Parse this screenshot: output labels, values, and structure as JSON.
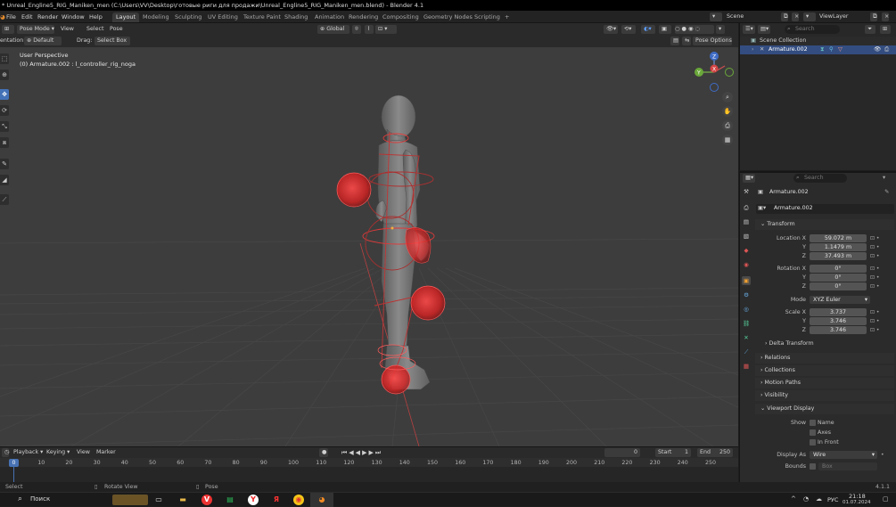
{
  "window_title": "* Unreal_Engline5_RIG_Maniken_men (C:\\Users\\VV\\Desktop\\готовые риги для продажи\\Unreal_Engline5_RIG_Maniken_men.blend) - Blender 4.1",
  "menu": [
    "File",
    "Edit",
    "Render",
    "Window",
    "Help"
  ],
  "workspaces": [
    "Layout",
    "Modeling",
    "Sculpting",
    "UV Editing",
    "Texture Paint",
    "Shading",
    "Animation",
    "Rendering",
    "Compositing",
    "Geometry Nodes",
    "Scripting"
  ],
  "workspace_add": "+",
  "scene": {
    "label": "Scene",
    "view_layer": "ViewLayer"
  },
  "viewport_header": {
    "orientation_label": "entation:",
    "orientation_value": "Default",
    "drag_label": "Drag:",
    "drag_value": "Select Box",
    "mode": "Pose Mode",
    "menus": [
      "View",
      "Select",
      "Pose"
    ],
    "transform": "Global",
    "pose_options": "Pose Options"
  },
  "viewport": {
    "perspective": "User Perspective",
    "object_info": "(0) Armature.002 : l_controller_rig_noga"
  },
  "gizmo": {
    "x": "X",
    "y": "Y",
    "z": "Z"
  },
  "timeline": {
    "menus": [
      "Playback",
      "Keying",
      "View",
      "Marker"
    ],
    "current_frame": "0",
    "start_label": "Start",
    "start": "1",
    "end_label": "End",
    "end": "250",
    "ticks": [
      "0",
      "10",
      "20",
      "30",
      "40",
      "50",
      "60",
      "70",
      "80",
      "90",
      "100",
      "110",
      "120",
      "130",
      "140",
      "150",
      "160",
      "170",
      "180",
      "190",
      "200",
      "210",
      "220",
      "230",
      "240",
      "250"
    ],
    "playhead": "0"
  },
  "statusbar": {
    "left": "Select",
    "middle": "Rotate View",
    "right": "Pose",
    "version": "4.1.1"
  },
  "taskbar": {
    "search": "Поиск",
    "lang": "РУС",
    "time": "21:18",
    "date": "01.07.2024"
  },
  "outliner": {
    "search_placeholder": "Search",
    "root": "Scene Collection",
    "item": "Armature.002"
  },
  "properties": {
    "search_placeholder": "Search",
    "object_name": "Armature.002",
    "data_name": "Armature.002",
    "transform_title": "Transform",
    "location_label": "Location X",
    "location": [
      "59.072 m",
      "1.1479 m",
      "37.493 m"
    ],
    "rotation_label": "Rotation X",
    "rotation": [
      "0°",
      "0°",
      "0°"
    ],
    "axis_y": "Y",
    "axis_z": "Z",
    "mode_label": "Mode",
    "mode": "XYZ Euler",
    "scale_label": "Scale X",
    "scale": [
      "3.737",
      "3.746",
      "3.746"
    ],
    "delta_transform": "Delta Transform",
    "sections": [
      "Relations",
      "Collections",
      "Motion Paths",
      "Visibility"
    ],
    "viewport_display": "Viewport Display",
    "show_label": "Show",
    "show_options": [
      "Name",
      "Axes",
      "In Front"
    ],
    "display_as_label": "Display As",
    "display_as": "Wire",
    "bounds_label": "Bounds",
    "bounds_value": "Box"
  },
  "colors": {
    "accent": "#4772b3",
    "bone": "#e03a3a",
    "workspace_active": "#3a3a3a"
  }
}
